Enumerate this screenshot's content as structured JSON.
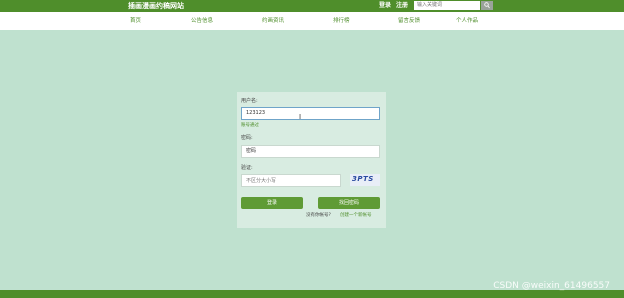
{
  "header": {
    "site_title": "插画漫画约稿网站",
    "login": "登录",
    "register": "注册",
    "search_placeholder": "输入关键词"
  },
  "nav": [
    "首页",
    "公告信息",
    "约画资讯",
    "排行榜",
    "留言反馈",
    "个人作品"
  ],
  "form": {
    "username_label": "用户名:",
    "username_value": "123123",
    "username_hint": "账号通过",
    "password_label": "密码:",
    "password_value": "密码",
    "captcha_label": "验证:",
    "captcha_placeholder": "不区分大小写",
    "captcha_text": "3PTS",
    "login_button": "登录",
    "reset_button": "找回密码",
    "no_account_text": "没有你帐号?",
    "create_account_link": "创建一个新帐号"
  },
  "watermark": "CSDN @weixin_61496557",
  "colors": {
    "brand_green": "#4f8e2b",
    "background": "#bfe1cf",
    "button_green": "#5f9b35"
  }
}
